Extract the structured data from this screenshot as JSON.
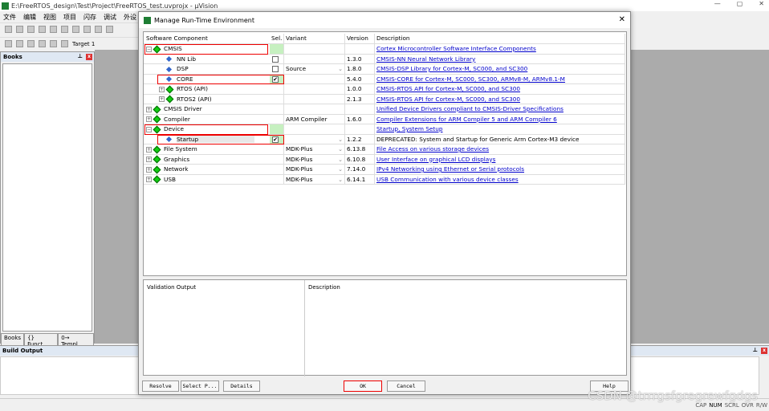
{
  "app": {
    "title": "E:\\FreeRTOS_design\\Test\\Project\\FreeRTOS_test.uvprojx - µVision",
    "logo": "V",
    "menu": [
      "文件",
      "编辑",
      "视图",
      "项目",
      "闪存",
      "调试",
      "外设"
    ],
    "target": "Target 1"
  },
  "books_panel": {
    "title": "Books",
    "tabs": [
      "Books",
      "{} Funct...",
      "0→ Templ..."
    ]
  },
  "build_output": {
    "title": "Build Output"
  },
  "status_bar": [
    "CAP",
    "NUM",
    "SCRL",
    "OVR",
    "R/W"
  ],
  "watermark": "CSDN @trrrgsfgregrewfgdgs",
  "dialog": {
    "title": "Manage Run-Time Environment",
    "columns": [
      "Software Component",
      "Sel.",
      "Variant",
      "Version",
      "Description"
    ],
    "rows": [
      {
        "name": "CMSIS",
        "level": 0,
        "type": "group",
        "expander": "minus",
        "sel": "",
        "selGreen": true,
        "variant": "",
        "version": "",
        "desc": "Cortex Microcontroller Software Interface Components",
        "link": true,
        "highlight": true
      },
      {
        "name": "NN Lib",
        "level": 1,
        "type": "item",
        "sel": "unchecked",
        "variant": "",
        "version": "1.3.0",
        "desc": "CMSIS-NN Neural Network Library",
        "link": true
      },
      {
        "name": "DSP",
        "level": 1,
        "type": "item",
        "sel": "unchecked",
        "variant": "Source",
        "dropdown": true,
        "version": "1.8.0",
        "desc": "CMSIS-DSP Library for Cortex-M, SC000, and SC300",
        "link": true
      },
      {
        "name": "CORE",
        "level": 1,
        "type": "item",
        "sel": "checked",
        "selGreen": true,
        "variant": "",
        "version": "5.4.0",
        "desc": "CMSIS-CORE for Cortex-M, SC000, SC300, ARMv8-M, ARMv8.1-M",
        "link": true,
        "highlight": true
      },
      {
        "name": "RTOS (API)",
        "level": 1,
        "type": "group",
        "expander": "plus",
        "sel": "",
        "variant": "",
        "version": "1.0.0",
        "desc": "CMSIS-RTOS API for Cortex-M, SC000, and SC300",
        "link": true
      },
      {
        "name": "RTOS2 (API)",
        "level": 1,
        "type": "group",
        "expander": "plus",
        "sel": "",
        "variant": "",
        "version": "2.1.3",
        "desc": "CMSIS-RTOS API for Cortex-M, SC000, and SC300",
        "link": true
      },
      {
        "name": "CMSIS Driver",
        "level": 0,
        "type": "group",
        "expander": "plus",
        "sel": "",
        "variant": "",
        "version": "",
        "desc": "Unified Device Drivers compliant to CMSIS-Driver Specifications",
        "link": true
      },
      {
        "name": "Compiler",
        "level": 0,
        "type": "group",
        "expander": "plus",
        "sel": "",
        "variant": "ARM Compiler",
        "version": "1.6.0",
        "desc": "Compiler Extensions for ARM Compiler 5 and ARM Compiler 6",
        "link": true
      },
      {
        "name": "Device",
        "level": 0,
        "type": "group",
        "expander": "minus",
        "sel": "",
        "selGreen": true,
        "variant": "",
        "version": "",
        "desc": "Startup, System Setup",
        "link": true,
        "highlight": true
      },
      {
        "name": "Startup",
        "level": 1,
        "type": "item",
        "sel": "checked",
        "selGreen": true,
        "variant": "",
        "dropdown": true,
        "version": "1.2.2",
        "desc": "DEPRECATED: System and Startup for Generic Arm Cortex-M3 device",
        "link": false,
        "highlight": true,
        "selected": true
      },
      {
        "name": "File System",
        "level": 0,
        "type": "group",
        "expander": "plus",
        "sel": "",
        "variant": "MDK-Plus",
        "dropdown": true,
        "version": "6.13.8",
        "desc": "File Access on various storage devices",
        "link": true
      },
      {
        "name": "Graphics",
        "level": 0,
        "type": "group",
        "expander": "plus",
        "sel": "",
        "variant": "MDK-Plus",
        "dropdown": true,
        "version": "6.10.8",
        "desc": "User Interface on graphical LCD displays",
        "link": true
      },
      {
        "name": "Network",
        "level": 0,
        "type": "group",
        "expander": "plus",
        "sel": "",
        "variant": "MDK-Plus",
        "dropdown": true,
        "version": "7.14.0",
        "desc": "IPv4 Networking using Ethernet or Serial protocols",
        "link": true
      },
      {
        "name": "USB",
        "level": 0,
        "type": "group",
        "expander": "plus",
        "sel": "",
        "variant": "MDK-Plus",
        "dropdown": true,
        "version": "6.14.1",
        "desc": "USB Communication with various device classes",
        "link": true
      }
    ],
    "validation_header": "Validation Output",
    "description_header": "Description",
    "buttons": {
      "resolve": "Resolve",
      "select": "Select P...",
      "details": "Details",
      "ok": "OK",
      "cancel": "Cancel",
      "help": "Help"
    }
  },
  "colors": {
    "highlight": "#e00000",
    "link": "#0000cc",
    "sel_green": "#c6f0c0",
    "gray_bg": "#ababab"
  }
}
